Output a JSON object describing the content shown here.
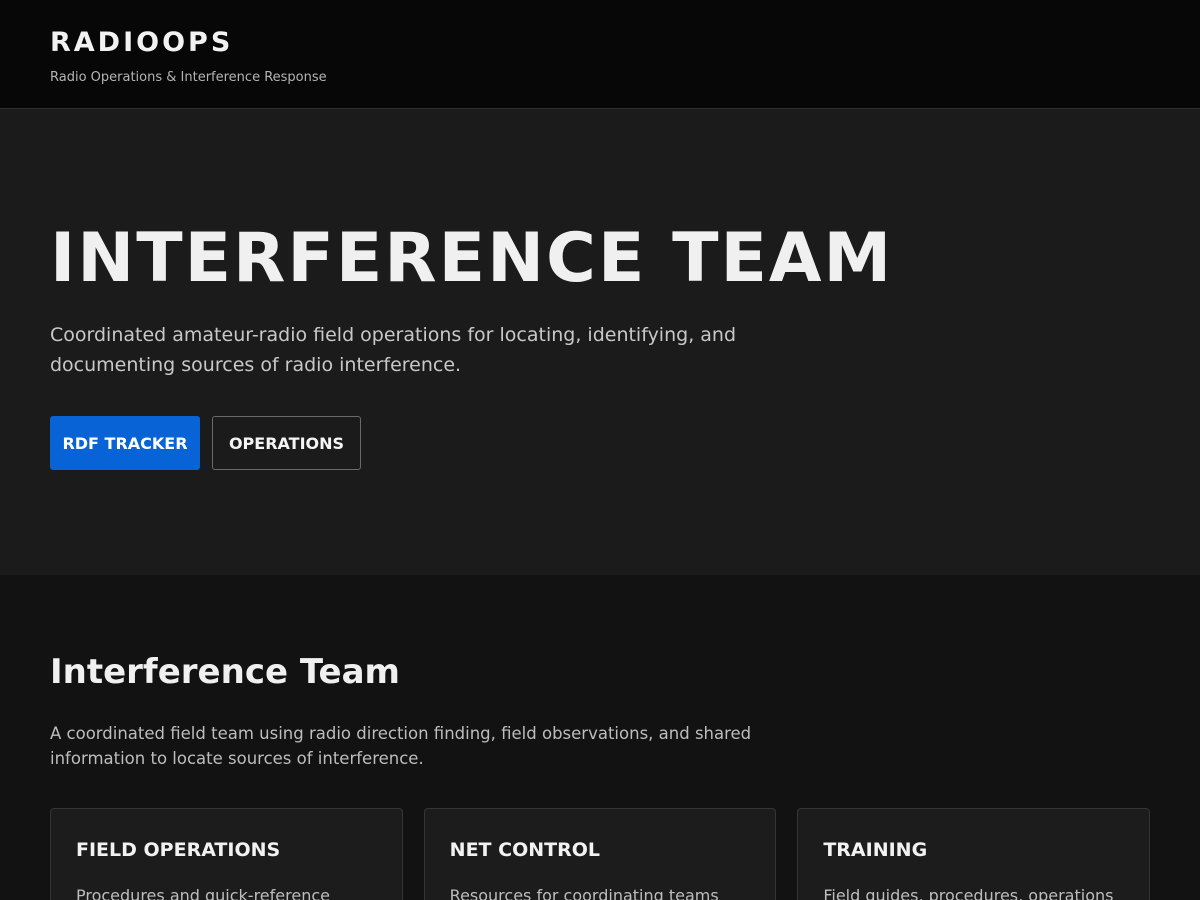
{
  "header": {
    "brand": "RADIOOPS",
    "tagline": "Radio Operations & Interference Response"
  },
  "hero": {
    "title": "INTERFERENCE TEAM",
    "description": "Coordinated amateur-radio field operations for locating, identifying, and documenting sources of radio interference.",
    "primary_button": "RDF TRACKER",
    "secondary_button": "OPERATIONS"
  },
  "section": {
    "title": "Interference Team",
    "description": "A coordinated field team using radio direction finding, field observations, and shared information to locate sources of interference.",
    "cards": [
      {
        "title": "FIELD OPERATIONS",
        "description": "Procedures and quick-reference"
      },
      {
        "title": "NET CONTROL",
        "description": "Resources for coordinating teams and"
      },
      {
        "title": "TRAINING",
        "description": "Field guides, procedures, operations"
      }
    ]
  },
  "colors": {
    "accent": "#0763d6",
    "header_bg": "#070707",
    "hero_bg": "#1b1b1b",
    "page_bg": "#121212",
    "card_bg": "#1c1c1c"
  }
}
